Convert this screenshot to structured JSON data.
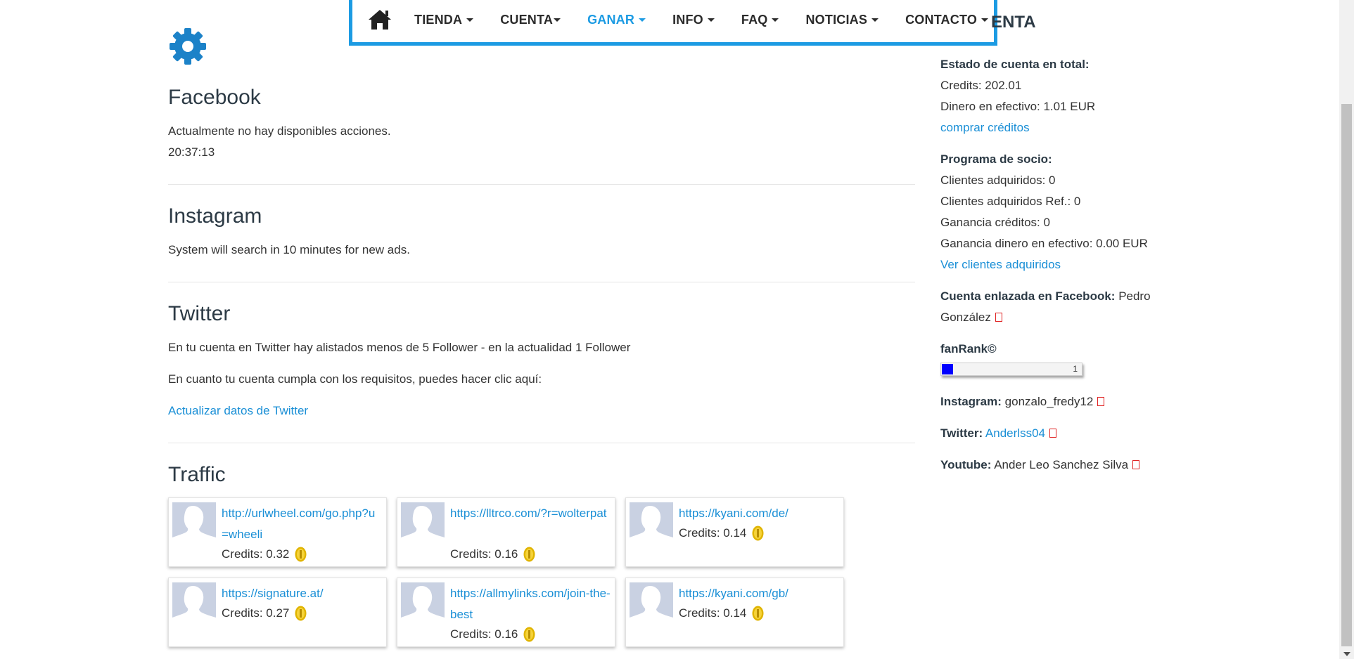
{
  "nav": {
    "home_icon": "home-icon",
    "items": [
      {
        "label": "TIENDA"
      },
      {
        "label": "CUENTA"
      },
      {
        "label": "GANAR",
        "active": true
      },
      {
        "label": "INFO"
      },
      {
        "label": "FAQ"
      },
      {
        "label": "NOTICIAS"
      },
      {
        "label": "CONTACTO"
      }
    ],
    "accent_color": "#1c9be3"
  },
  "settings_icon": "gear-icon",
  "facebook": {
    "title": "Facebook",
    "message": "Actualmente no hay disponibles acciones.",
    "time": "20:37:13"
  },
  "instagram": {
    "title": "Instagram",
    "message": "System will search in 10 minutes for new ads."
  },
  "twitter": {
    "title": "Twitter",
    "message": "En tu cuenta en Twitter hay alistados menos de 5 Follower - en la actualidad 1 Follower",
    "requirement": "En cuanto tu cuenta cumpla con los requisitos, puedes hacer clic aquí:",
    "update_link": "Actualizar datos de Twitter"
  },
  "traffic": {
    "title": "Traffic",
    "cards": [
      {
        "url": "http://urlwheel.com/go.php?u=wheeli",
        "credits": "Credits: 0.32"
      },
      {
        "url": "https://lltrco.com/?r=wolterpat",
        "credits": "Credits: 0.16"
      },
      {
        "url": "https://kyani.com/de/",
        "credits": "Credits: 0.14"
      },
      {
        "url": "https://signature.at/",
        "credits": "Credits: 0.27"
      },
      {
        "url": "https://allmylinks.com/join-the-best",
        "credits": "Credits: 0.16"
      },
      {
        "url": "https://kyani.com/gb/",
        "credits": "Credits: 0.14"
      }
    ]
  },
  "sidebar": {
    "header_partial": "ENTA",
    "account_total_label": "Estado de cuenta en total:",
    "credits": "Credits: 202.01",
    "cash": "Dinero en efectivo: 1.01 EUR",
    "buy_credits": "comprar créditos",
    "partner_label": "Programa de socio:",
    "clients": "Clientes adquiridos: 0",
    "clients_ref": "Clientes adquiridos Ref.: 0",
    "credit_gain": "Ganancia créditos: 0",
    "cash_gain": "Ganancia dinero en efectivo: 0.00 EUR",
    "see_clients": "Ver clientes adquiridos",
    "fb_label": "Cuenta enlazada en Facebook:",
    "fb_name_1": "Pedro",
    "fb_name_2": "González",
    "fanrank_label": "fanRank©",
    "fanrank_value": "1",
    "fanrank_fraction": 0.08,
    "instagram_label": "Instagram:",
    "instagram_user": "gonzalo_fredy12",
    "twitter_label": "Twitter:",
    "twitter_user": "Anderlss04",
    "youtube_label": "Youtube:",
    "youtube_user": "Ander Leo Sanchez Silva"
  }
}
